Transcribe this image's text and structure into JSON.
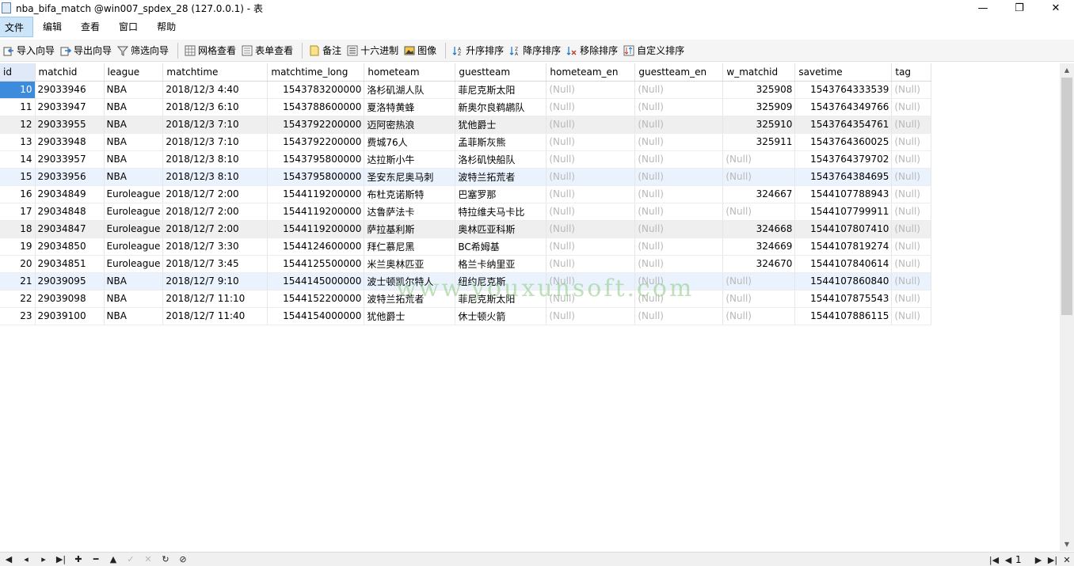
{
  "window": {
    "title": "nba_bifa_match @win007_spdex_28 (127.0.0.1) - 表",
    "minimize": "—",
    "maximize": "❐",
    "close": "✕"
  },
  "menu": {
    "items": [
      "文件",
      "编辑",
      "查看",
      "窗口",
      "帮助"
    ]
  },
  "toolbar": {
    "import": "导入向导",
    "export": "导出向导",
    "filter": "筛选向导",
    "grid_view": "网格查看",
    "form_view": "表单查看",
    "memo": "备注",
    "hex": "十六进制",
    "image": "图像",
    "sort_asc": "升序排序",
    "sort_desc": "降序排序",
    "remove_sort": "移除排序",
    "custom_sort": "自定义排序"
  },
  "table": {
    "columns": [
      "id",
      "matchid",
      "league",
      "matchtime",
      "matchtime_long",
      "hometeam",
      "guestteam",
      "hometeam_en",
      "guestteam_en",
      "w_matchid",
      "savetime",
      "tag"
    ],
    "null_text": "(Null)",
    "rows": [
      [
        "10",
        "29033946",
        "NBA",
        "2018/12/3 4:40",
        "1543783200000",
        "洛杉矶湖人队",
        "菲尼克斯太阳",
        "(Null)",
        "(Null)",
        "325908",
        "1543764333539",
        "(Null)"
      ],
      [
        "11",
        "29033947",
        "NBA",
        "2018/12/3 6:10",
        "1543788600000",
        "夏洛特黄蜂",
        "新奥尔良鹈鹕队",
        "(Null)",
        "(Null)",
        "325909",
        "1543764349766",
        "(Null)"
      ],
      [
        "12",
        "29033955",
        "NBA",
        "2018/12/3 7:10",
        "1543792200000",
        "迈阿密热浪",
        "犹他爵士",
        "(Null)",
        "(Null)",
        "325910",
        "1543764354761",
        "(Null)"
      ],
      [
        "13",
        "29033948",
        "NBA",
        "2018/12/3 7:10",
        "1543792200000",
        "费城76人",
        "孟菲斯灰熊",
        "(Null)",
        "(Null)",
        "325911",
        "1543764360025",
        "(Null)"
      ],
      [
        "14",
        "29033957",
        "NBA",
        "2018/12/3 8:10",
        "1543795800000",
        "达拉斯小牛",
        "洛杉矶快船队",
        "(Null)",
        "(Null)",
        "(Null)",
        "1543764379702",
        "(Null)"
      ],
      [
        "15",
        "29033956",
        "NBA",
        "2018/12/3 8:10",
        "1543795800000",
        "圣安东尼奥马刺",
        "波特兰拓荒者",
        "(Null)",
        "(Null)",
        "(Null)",
        "1543764384695",
        "(Null)"
      ],
      [
        "16",
        "29034849",
        "Euroleague",
        "2018/12/7 2:00",
        "1544119200000",
        "布杜克诺斯特",
        "巴塞罗那",
        "(Null)",
        "(Null)",
        "324667",
        "1544107788943",
        "(Null)"
      ],
      [
        "17",
        "29034848",
        "Euroleague",
        "2018/12/7 2:00",
        "1544119200000",
        "达鲁萨法卡",
        "特拉维夫马卡比",
        "(Null)",
        "(Null)",
        "(Null)",
        "1544107799911",
        "(Null)"
      ],
      [
        "18",
        "29034847",
        "Euroleague",
        "2018/12/7 2:00",
        "1544119200000",
        "萨拉基利斯",
        "奥林匹亚科斯",
        "(Null)",
        "(Null)",
        "324668",
        "1544107807410",
        "(Null)"
      ],
      [
        "19",
        "29034850",
        "Euroleague",
        "2018/12/7 3:30",
        "1544124600000",
        "拜仁慕尼黑",
        "BC希姆基",
        "(Null)",
        "(Null)",
        "324669",
        "1544107819274",
        "(Null)"
      ],
      [
        "20",
        "29034851",
        "Euroleague",
        "2018/12/7 3:45",
        "1544125500000",
        "米兰奥林匹亚",
        "格兰卡纳里亚",
        "(Null)",
        "(Null)",
        "324670",
        "1544107840614",
        "(Null)"
      ],
      [
        "21",
        "29039095",
        "NBA",
        "2018/12/7 9:10",
        "1544145000000",
        "波士顿凯尔特人",
        "纽约尼克斯",
        "(Null)",
        "(Null)",
        "(Null)",
        "1544107860840",
        "(Null)"
      ],
      [
        "22",
        "29039098",
        "NBA",
        "2018/12/7 11:10",
        "1544152200000",
        "波特兰拓荒者",
        "菲尼克斯太阳",
        "(Null)",
        "(Null)",
        "(Null)",
        "1544107875543",
        "(Null)"
      ],
      [
        "23",
        "29039100",
        "NBA",
        "2018/12/7 11:40",
        "1544154000000",
        "犹他爵士",
        "休士顿火箭",
        "(Null)",
        "(Null)",
        "(Null)",
        "1544107886115",
        "(Null)"
      ]
    ]
  },
  "watermark": "www.youxunsoft.com",
  "status": {
    "page": "1"
  },
  "colors": {
    "selection": "#3c8bdc",
    "null_text": "#b8b8b8",
    "menu_active": "#cce4f7"
  }
}
